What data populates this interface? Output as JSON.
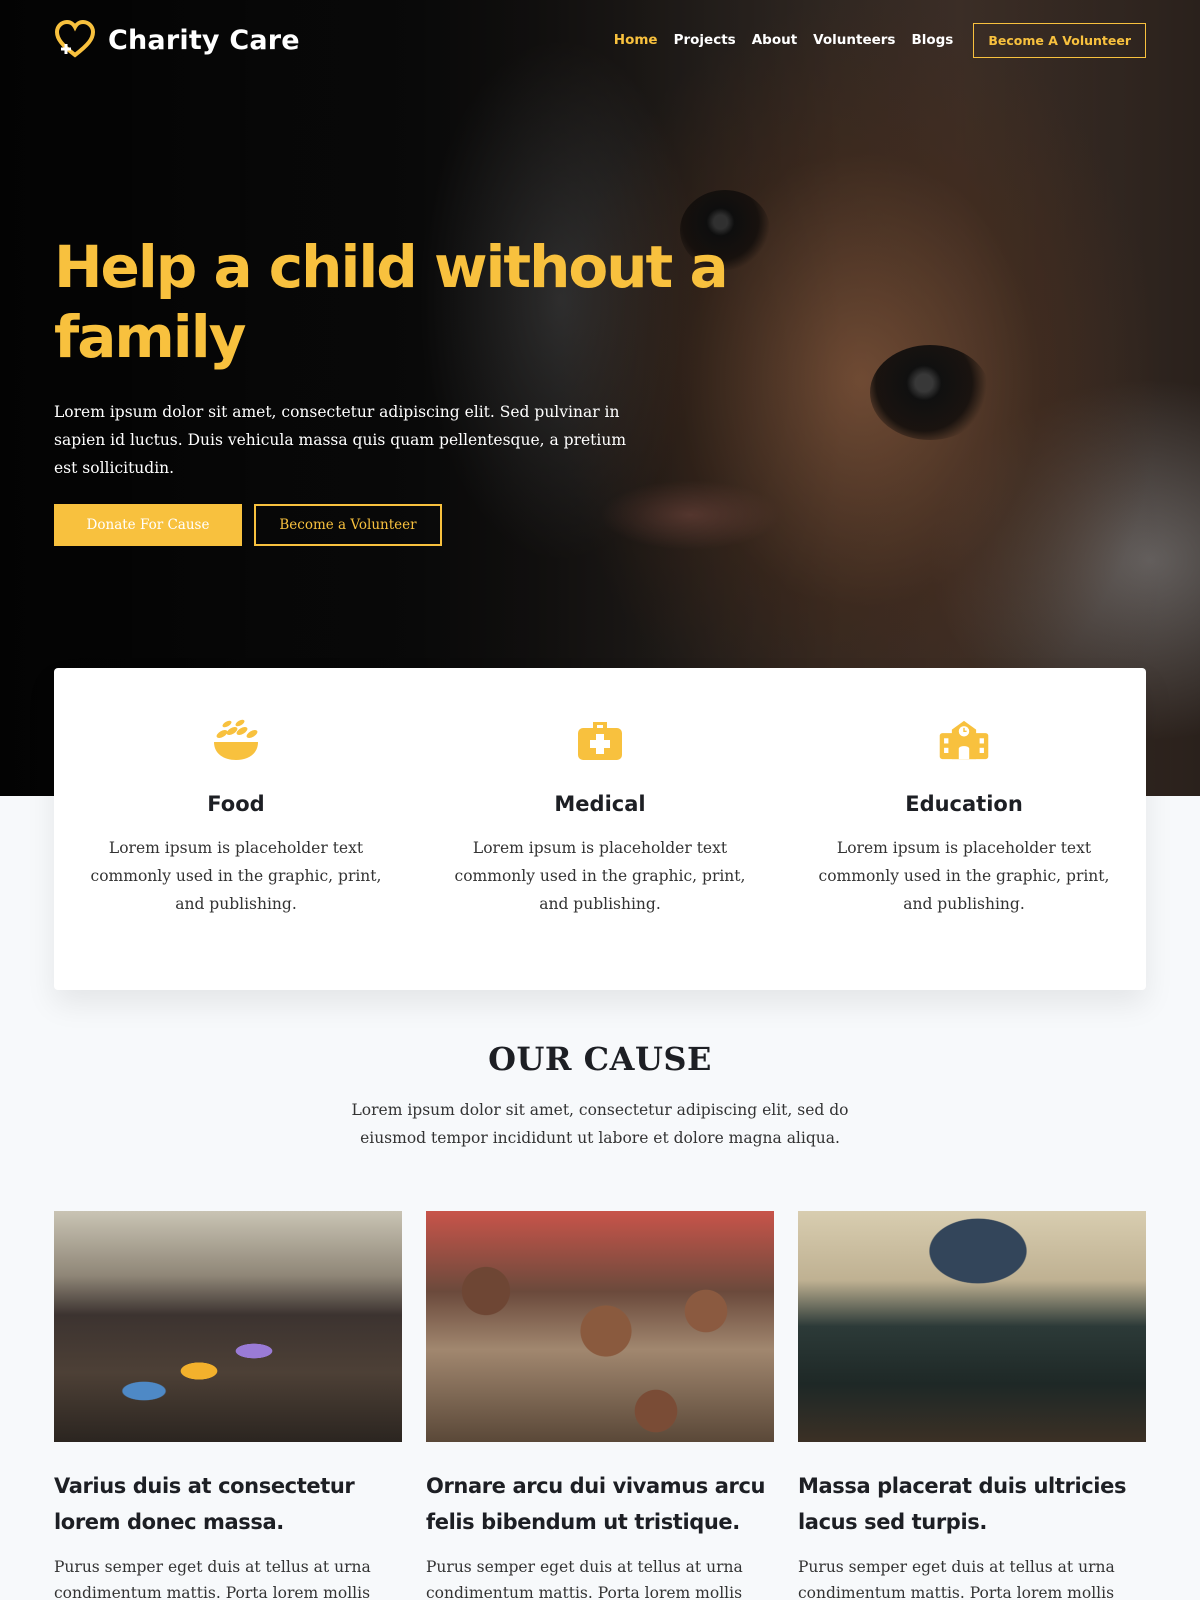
{
  "brand": {
    "name": "Charity Care",
    "accent": "#f8c13e",
    "icon": "heart-logo-icon"
  },
  "nav": {
    "items": [
      {
        "label": "Home",
        "active": true
      },
      {
        "label": "Projects",
        "active": false
      },
      {
        "label": "About",
        "active": false
      },
      {
        "label": "Volunteers",
        "active": false
      },
      {
        "label": "Blogs",
        "active": false
      }
    ],
    "cta_label": "Become A Volunteer"
  },
  "hero": {
    "title": "Help a child without a family",
    "text": "Lorem ipsum dolor sit amet, consectetur adipiscing elit. Sed pulvinar in sapien id luctus. Duis vehicula massa quis quam pellentesque, a pretium est sollicitudin.",
    "donate_label": "Donate For Cause",
    "volunteer_label": "Become a Volunteer"
  },
  "features": [
    {
      "icon": "food-bowl-icon",
      "title": "Food",
      "text": "Lorem ipsum is placeholder text commonly used in the graphic, print, and publishing."
    },
    {
      "icon": "medical-kit-icon",
      "title": "Medical",
      "text": "Lorem ipsum is placeholder text commonly used in the graphic, print, and publishing."
    },
    {
      "icon": "school-icon",
      "title": "Education",
      "text": "Lorem ipsum is placeholder text commonly used in the graphic, print, and publishing."
    }
  ],
  "cause": {
    "title": "OUR CAUSE",
    "subtitle": "Lorem ipsum dolor sit amet, consectetur adipiscing elit, sed do eiusmod tempor incididunt ut labore et dolore magna aliqua.",
    "cards": [
      {
        "title": "Varius duis at consectetur lorem donec massa.",
        "text": "Purus semper eget duis at tellus at urna condimentum mattis. Porta lorem mollis"
      },
      {
        "title": "Ornare arcu dui vivamus arcu felis bibendum ut tristique.",
        "text": "Purus semper eget duis at tellus at urna condimentum mattis. Porta lorem mollis"
      },
      {
        "title": "Massa placerat duis ultricies lacus sed turpis.",
        "text": "Purus semper eget duis at tellus at urna condimentum mattis. Porta lorem mollis"
      }
    ]
  }
}
